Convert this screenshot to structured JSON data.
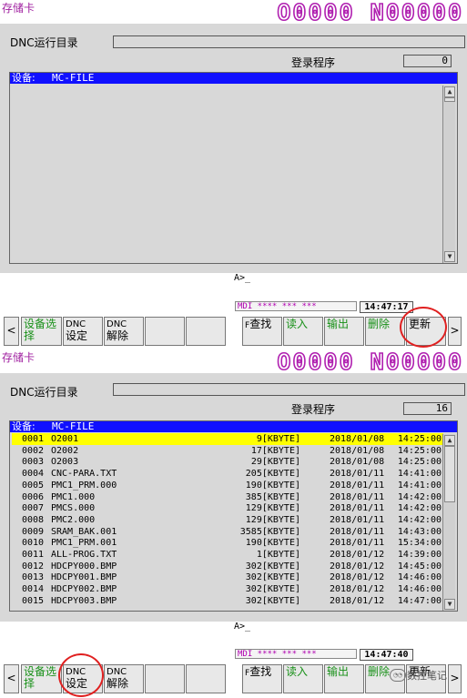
{
  "top": {
    "mode": "存储卡",
    "program_no": "O0000 N00000",
    "title": "DNC运行目录",
    "reg_label": "登录程序",
    "reg_count": "0",
    "device_label": "设备:",
    "device_value": "MC-FILE",
    "files": [],
    "cmd": "A>_",
    "mdi": "MDI **** *** ***",
    "clock": "14:47:17"
  },
  "bottom": {
    "mode": "存储卡",
    "program_no": "O0000 N00000",
    "title": "DNC运行目录",
    "reg_label": "登录程序",
    "reg_count": "16",
    "device_label": "设备:",
    "device_value": "MC-FILE",
    "files": [
      {
        "no": "0001",
        "name": "O2001",
        "size": "9[KBYTE]",
        "date": "2018/01/08",
        "time": "14:25:00"
      },
      {
        "no": "0002",
        "name": "O2002",
        "size": "17[KBYTE]",
        "date": "2018/01/08",
        "time": "14:25:00"
      },
      {
        "no": "0003",
        "name": "O2003",
        "size": "29[KBYTE]",
        "date": "2018/01/08",
        "time": "14:25:00"
      },
      {
        "no": "0004",
        "name": "CNC-PARA.TXT",
        "size": "205[KBYTE]",
        "date": "2018/01/11",
        "time": "14:41:00"
      },
      {
        "no": "0005",
        "name": "PMC1_PRM.000",
        "size": "190[KBYTE]",
        "date": "2018/01/11",
        "time": "14:41:00"
      },
      {
        "no": "0006",
        "name": "PMC1.000",
        "size": "385[KBYTE]",
        "date": "2018/01/11",
        "time": "14:42:00"
      },
      {
        "no": "0007",
        "name": "PMCS.000",
        "size": "129[KBYTE]",
        "date": "2018/01/11",
        "time": "14:42:00"
      },
      {
        "no": "0008",
        "name": "PMC2.000",
        "size": "129[KBYTE]",
        "date": "2018/01/11",
        "time": "14:42:00"
      },
      {
        "no": "0009",
        "name": "SRAM_BAK.001",
        "size": "3585[KBYTE]",
        "date": "2018/01/11",
        "time": "14:43:00"
      },
      {
        "no": "0010",
        "name": "PMC1_PRM.001",
        "size": "190[KBYTE]",
        "date": "2018/01/11",
        "time": "15:34:00"
      },
      {
        "no": "0011",
        "name": "ALL-PROG.TXT",
        "size": "1[KBYTE]",
        "date": "2018/01/12",
        "time": "14:39:00"
      },
      {
        "no": "0012",
        "name": "HDCPY000.BMP",
        "size": "302[KBYTE]",
        "date": "2018/01/12",
        "time": "14:45:00"
      },
      {
        "no": "0013",
        "name": "HDCPY001.BMP",
        "size": "302[KBYTE]",
        "date": "2018/01/12",
        "time": "14:46:00"
      },
      {
        "no": "0014",
        "name": "HDCPY002.BMP",
        "size": "302[KBYTE]",
        "date": "2018/01/12",
        "time": "14:46:00"
      },
      {
        "no": "0015",
        "name": "HDCPY003.BMP",
        "size": "302[KBYTE]",
        "date": "2018/01/12",
        "time": "14:47:00"
      }
    ],
    "cmd": "A>_",
    "mdi": "MDI **** *** ***",
    "clock": "14:47:40"
  },
  "softkeys": {
    "prev": "<",
    "device_select": "设备选择",
    "dnc_setting_top": "DNC",
    "dnc_setting_bottom": "设定",
    "dnc_release_top": "DNC",
    "dnc_release_bottom": "解除",
    "find_prefix": "F",
    "find": "查找",
    "read": "读入",
    "output": "输出",
    "delete": "删除",
    "update": "更新",
    "next": ">"
  },
  "watermark": "数控笔记",
  "colors": {
    "device_bar": "#1010ff",
    "selected_row": "#ffff00",
    "program_no": "#b020b0",
    "softkey_text": "#189018",
    "highlight_circle": "#e02020"
  }
}
